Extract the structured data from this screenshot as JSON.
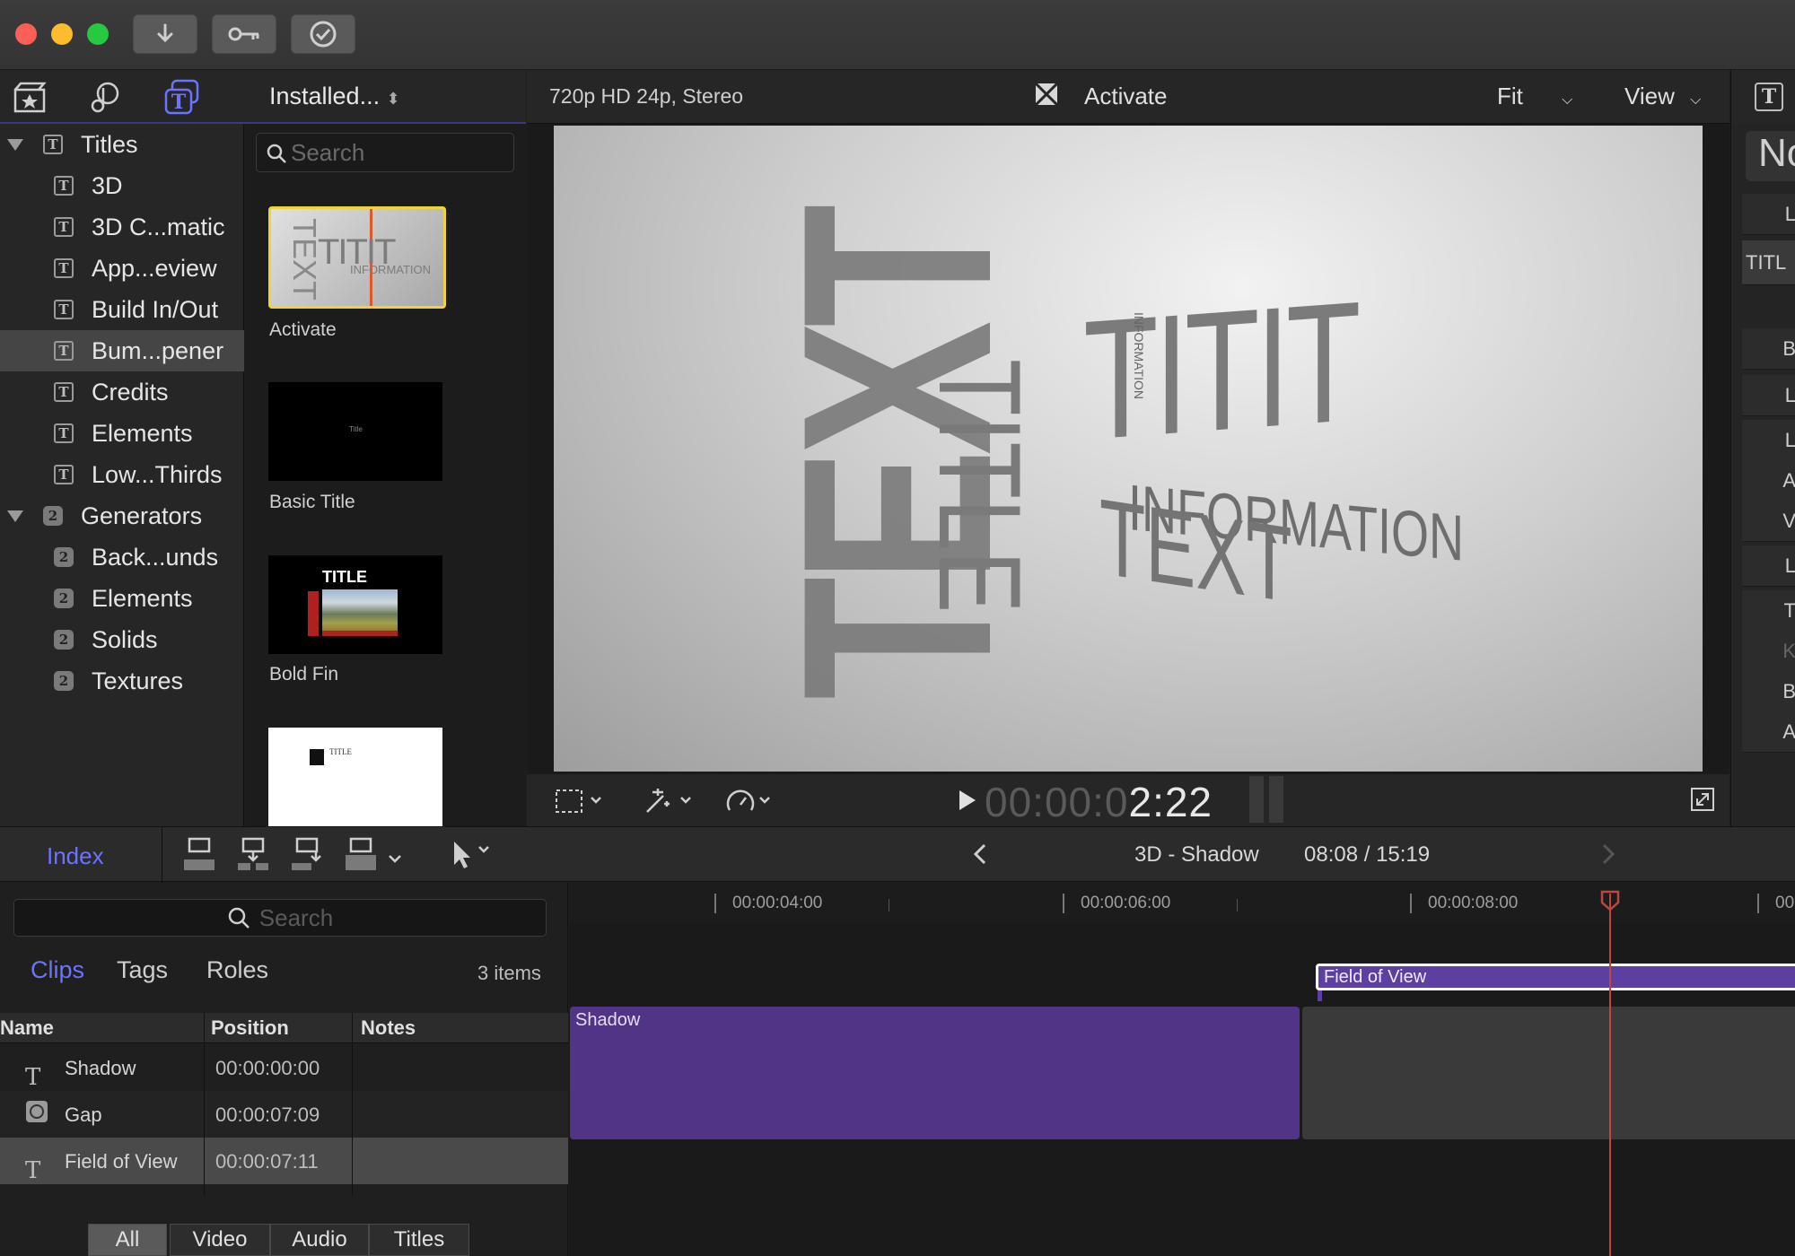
{
  "colors": {
    "accent": "#6b73ff",
    "clip_purple": "#513485",
    "selection_yellow": "#f0d23c",
    "playhead": "#c0473f"
  },
  "titlebar": {
    "buttons": [
      "import-icon",
      "key-icon",
      "checkmark-icon"
    ]
  },
  "browser": {
    "library_icons": [
      "clapper-star-icon",
      "music-photo-icon",
      "titles-generators-icon"
    ],
    "popup_label": "Installed...",
    "search_placeholder": "Search",
    "sidebar": [
      {
        "label": "Titles",
        "icon": "titles-icon",
        "disclosure": true
      },
      {
        "label": "3D",
        "icon": "titles-icon"
      },
      {
        "label": "3D C...matic",
        "icon": "titles-icon"
      },
      {
        "label": "App...eview",
        "icon": "titles-icon"
      },
      {
        "label": "Build In/Out",
        "icon": "titles-icon"
      },
      {
        "label": "Bum...pener",
        "icon": "titles-icon",
        "selected": true
      },
      {
        "label": "Credits",
        "icon": "titles-icon"
      },
      {
        "label": "Elements",
        "icon": "titles-icon"
      },
      {
        "label": "Low...Thirds",
        "icon": "titles-icon"
      },
      {
        "label": "Generators",
        "icon": "generator-icon",
        "disclosure": true
      },
      {
        "label": "Back...unds",
        "icon": "generator-icon"
      },
      {
        "label": "Elements",
        "icon": "generator-icon"
      },
      {
        "label": "Solids",
        "icon": "generator-icon"
      },
      {
        "label": "Textures",
        "icon": "generator-icon"
      }
    ],
    "thumbnails": [
      {
        "label": "Activate",
        "selected": true
      },
      {
        "label": "Basic Title",
        "inner": "Title"
      },
      {
        "label": "Bold Fin",
        "inner": "TITLE"
      },
      {
        "label": "",
        "inner": "TITLE"
      }
    ]
  },
  "viewer": {
    "format": "720p HD 24p, Stereo",
    "clip_name": "Activate",
    "zoom": "Fit",
    "view_label": "View",
    "timecode_dim": "00:00:0",
    "timecode_bright": "2:22",
    "canvas_text": {
      "title": "TITLE",
      "titit": "TITIT",
      "information": "INFORMATION",
      "text": "TEXT",
      "small": "INFORMATION"
    }
  },
  "inspector": {
    "title_prefix": "No",
    "rows": [
      "L",
      "TITL",
      "B",
      "L",
      "L",
      "A",
      "V",
      "L",
      "T",
      "K",
      "B",
      "A"
    ]
  },
  "timeline_toolbar": {
    "index_label": "Index",
    "project_name": "3D - Shadow",
    "duration": "08:08 / 15:19"
  },
  "index": {
    "search_placeholder": "Search",
    "tabs": [
      "Clips",
      "Tags",
      "Roles"
    ],
    "item_count": "3 items",
    "columns": [
      "Name",
      "Position",
      "Notes"
    ],
    "rows": [
      {
        "icon": "title-t-icon",
        "name": "Shadow",
        "position": "00:00:00:00",
        "notes": ""
      },
      {
        "icon": "gap-icon",
        "name": "Gap",
        "position": "00:00:07:09",
        "notes": ""
      },
      {
        "icon": "title-t-icon",
        "name": "Field of View",
        "position": "00:00:07:11",
        "notes": "",
        "selected": true
      }
    ],
    "filters": [
      "All",
      "Video",
      "Audio",
      "Titles"
    ]
  },
  "timeline": {
    "ruler": [
      "00:00:04:00",
      "00:00:06:00",
      "00:00:08:00",
      "00"
    ],
    "clips": {
      "shadow": "Shadow",
      "field_of_view": "Field of View"
    }
  }
}
